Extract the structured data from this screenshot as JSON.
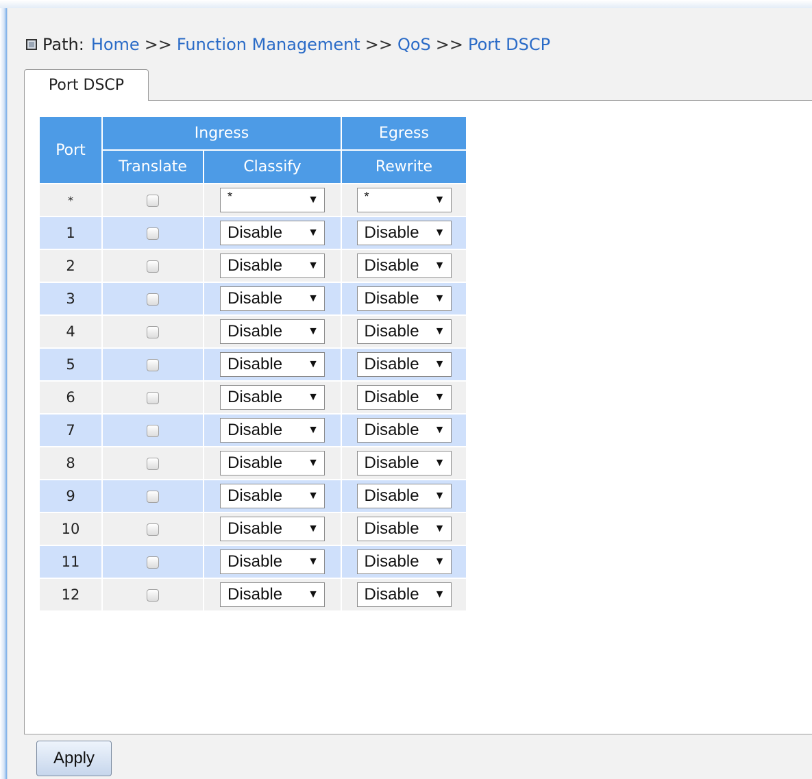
{
  "breadcrumb": {
    "label": "Path:",
    "separator": ">>",
    "items": [
      "Home",
      "Function Management",
      "QoS",
      "Port DSCP"
    ]
  },
  "tab": {
    "label": "Port DSCP"
  },
  "table": {
    "headers": {
      "port": "Port",
      "ingress": "Ingress",
      "egress": "Egress",
      "translate": "Translate",
      "classify": "Classify",
      "rewrite": "Rewrite"
    },
    "rows": [
      {
        "port": "*",
        "translate": false,
        "classify": "*",
        "rewrite": "*"
      },
      {
        "port": "1",
        "translate": false,
        "classify": "Disable",
        "rewrite": "Disable"
      },
      {
        "port": "2",
        "translate": false,
        "classify": "Disable",
        "rewrite": "Disable"
      },
      {
        "port": "3",
        "translate": false,
        "classify": "Disable",
        "rewrite": "Disable"
      },
      {
        "port": "4",
        "translate": false,
        "classify": "Disable",
        "rewrite": "Disable"
      },
      {
        "port": "5",
        "translate": false,
        "classify": "Disable",
        "rewrite": "Disable"
      },
      {
        "port": "6",
        "translate": false,
        "classify": "Disable",
        "rewrite": "Disable"
      },
      {
        "port": "7",
        "translate": false,
        "classify": "Disable",
        "rewrite": "Disable"
      },
      {
        "port": "8",
        "translate": false,
        "classify": "Disable",
        "rewrite": "Disable"
      },
      {
        "port": "9",
        "translate": false,
        "classify": "Disable",
        "rewrite": "Disable"
      },
      {
        "port": "10",
        "translate": false,
        "classify": "Disable",
        "rewrite": "Disable"
      },
      {
        "port": "11",
        "translate": false,
        "classify": "Disable",
        "rewrite": "Disable"
      },
      {
        "port": "12",
        "translate": false,
        "classify": "Disable",
        "rewrite": "Disable"
      }
    ]
  },
  "buttons": {
    "apply": "Apply"
  },
  "colors": {
    "header_bg": "#4d9be6",
    "row_alt_bg": "#cfe0fb",
    "row_bg": "#f0f0f0",
    "link": "#2a6bc7"
  }
}
